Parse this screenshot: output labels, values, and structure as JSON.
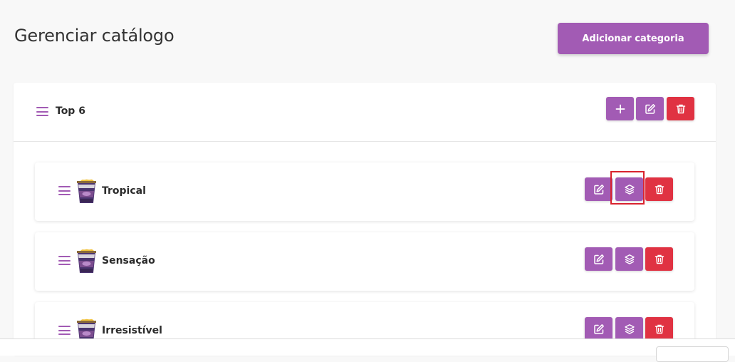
{
  "page": {
    "title": "Gerenciar catálogo",
    "add_category_label": "Adicionar categoria"
  },
  "colors": {
    "brand_purple": "#a25bb4",
    "danger_red": "#e03242",
    "highlight_red": "#d9232e"
  },
  "category": {
    "name": "Top 6",
    "actions": [
      {
        "icon": "plus-icon",
        "label": "add"
      },
      {
        "icon": "edit-icon",
        "label": "edit"
      },
      {
        "icon": "trash-icon",
        "label": "delete"
      }
    ],
    "products": [
      {
        "name": "Tropical",
        "icon_actions": [
          "edit-icon",
          "layers-icon",
          "trash-icon"
        ],
        "highlighted_action": "layers-icon"
      },
      {
        "name": "Sensação",
        "icon_actions": [
          "edit-icon",
          "layers-icon",
          "trash-icon"
        ]
      },
      {
        "name": "Irresistível",
        "icon_actions": [
          "edit-icon",
          "layers-icon",
          "trash-icon"
        ]
      }
    ]
  }
}
